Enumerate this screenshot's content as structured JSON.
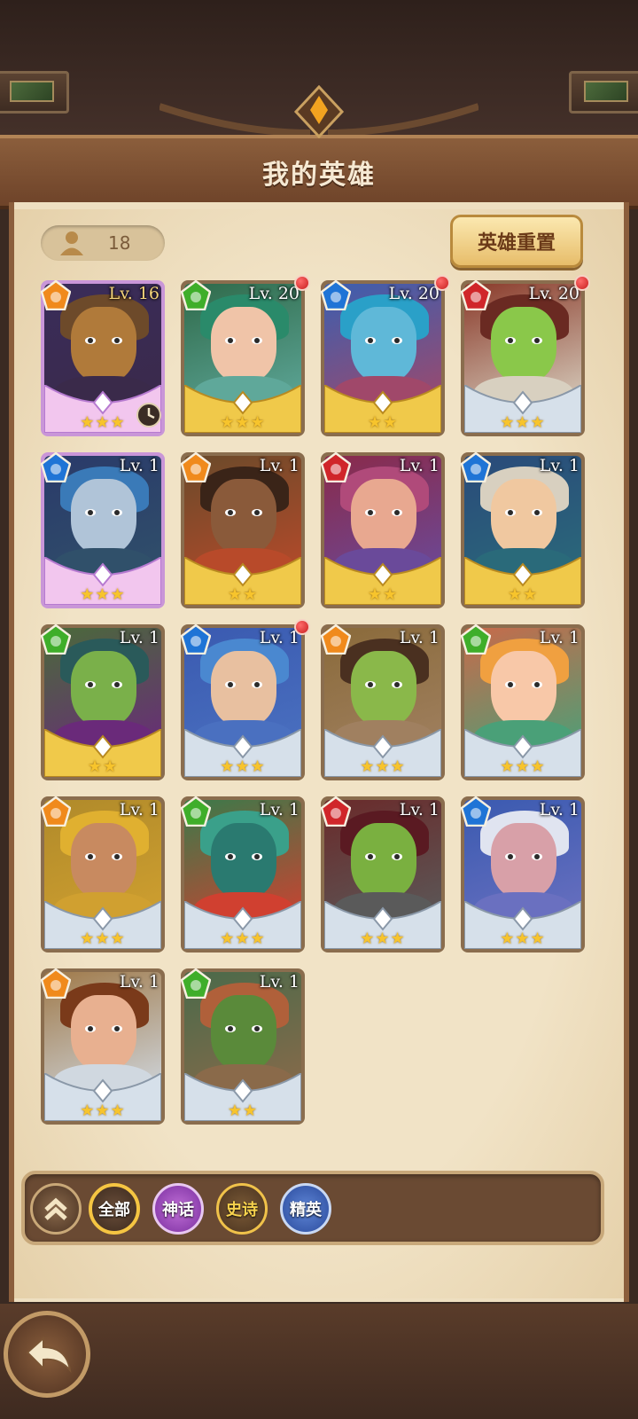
{
  "header": {
    "title": "我的英雄"
  },
  "hero_count": "18",
  "reset_button_label": "英雄重置",
  "filters": [
    {
      "label": "全部",
      "selected": true
    },
    {
      "label": "神话",
      "selected": false
    },
    {
      "label": "史诗",
      "selected": false
    },
    {
      "label": "精英",
      "selected": false
    }
  ],
  "heroes": [
    {
      "level": "Lv. 16",
      "element": "fire",
      "stars": 3,
      "rarity": "mythic",
      "red_dot": false,
      "timer_icon": true
    },
    {
      "level": "Lv. 20",
      "element": "nature",
      "stars": 3,
      "rarity": "epic",
      "red_dot": true
    },
    {
      "level": "Lv. 20",
      "element": "water",
      "stars": 2,
      "rarity": "epic",
      "red_dot": true
    },
    {
      "level": "Lv. 20",
      "element": "blood",
      "stars": 3,
      "rarity": "elite",
      "red_dot": true
    },
    {
      "level": "Lv. 1",
      "element": "water",
      "stars": 3,
      "rarity": "mythic",
      "red_dot": false
    },
    {
      "level": "Lv. 1",
      "element": "fire",
      "stars": 2,
      "rarity": "epic",
      "red_dot": false
    },
    {
      "level": "Lv. 1",
      "element": "blood",
      "stars": 2,
      "rarity": "epic",
      "red_dot": false
    },
    {
      "level": "Lv. 1",
      "element": "water",
      "stars": 2,
      "rarity": "epic",
      "red_dot": false
    },
    {
      "level": "Lv. 1",
      "element": "nature",
      "stars": 2,
      "rarity": "epic",
      "red_dot": false
    },
    {
      "level": "Lv. 1",
      "element": "water",
      "stars": 3,
      "rarity": "elite",
      "red_dot": true
    },
    {
      "level": "Lv. 1",
      "element": "fire",
      "stars": 3,
      "rarity": "elite",
      "red_dot": false
    },
    {
      "level": "Lv. 1",
      "element": "nature",
      "stars": 3,
      "rarity": "elite",
      "red_dot": false
    },
    {
      "level": "Lv. 1",
      "element": "fire",
      "stars": 3,
      "rarity": "elite",
      "red_dot": false
    },
    {
      "level": "Lv. 1",
      "element": "nature",
      "stars": 3,
      "rarity": "elite",
      "red_dot": false
    },
    {
      "level": "Lv. 1",
      "element": "blood",
      "stars": 3,
      "rarity": "elite",
      "red_dot": false
    },
    {
      "level": "Lv. 1",
      "element": "water",
      "stars": 3,
      "rarity": "elite",
      "red_dot": false
    },
    {
      "level": "Lv. 1",
      "element": "fire",
      "stars": 3,
      "rarity": "elite",
      "red_dot": false
    },
    {
      "level": "Lv. 1",
      "element": "nature",
      "stars": 2,
      "rarity": "elite",
      "red_dot": false
    }
  ],
  "colors": {
    "fire": "#f08a1c",
    "nature": "#3fae2a",
    "water": "#1f74d6",
    "blood": "#d0262a",
    "star": "#f7c42c",
    "panel": "#eedfc1"
  }
}
